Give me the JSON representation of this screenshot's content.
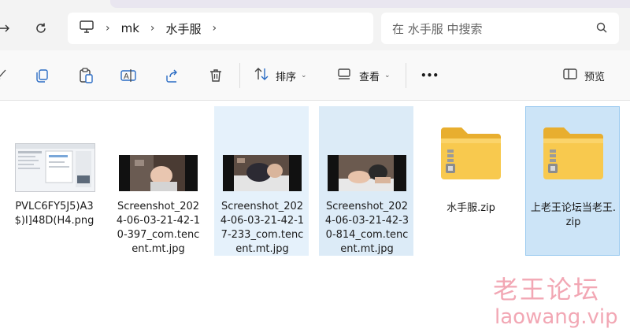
{
  "address": {
    "path": [
      "mk",
      "水手服"
    ]
  },
  "search": {
    "placeholder": "在 水手服 中搜索"
  },
  "toolbar": {
    "sort_label": "排序",
    "view_label": "查看",
    "more_label": "•••",
    "preview_label": "预览"
  },
  "files": [
    {
      "name": "PVLC6FY5J5)A3$)I]48D(H4.png",
      "kind": "image"
    },
    {
      "name": "Screenshot_2024-06-03-21-42-10-397_com.tencent.mt.jpg",
      "kind": "image"
    },
    {
      "name": "Screenshot_2024-06-03-21-42-17-233_com.tencent.mt.jpg",
      "kind": "image"
    },
    {
      "name": "Screenshot_2024-06-03-21-42-30-814_com.tencent.mt.jpg",
      "kind": "image"
    },
    {
      "name": "水手服.zip",
      "kind": "zip-folder"
    },
    {
      "name": "上老王论坛当老王.zip",
      "kind": "zip-folder"
    }
  ],
  "watermark": {
    "cn": "老王论坛",
    "en": "laowang.vip"
  },
  "colors": {
    "selection": "#cce4f7",
    "hover": "#e5f1fb",
    "folder": "#f6c44a",
    "watermark": "#f2a7b4"
  }
}
